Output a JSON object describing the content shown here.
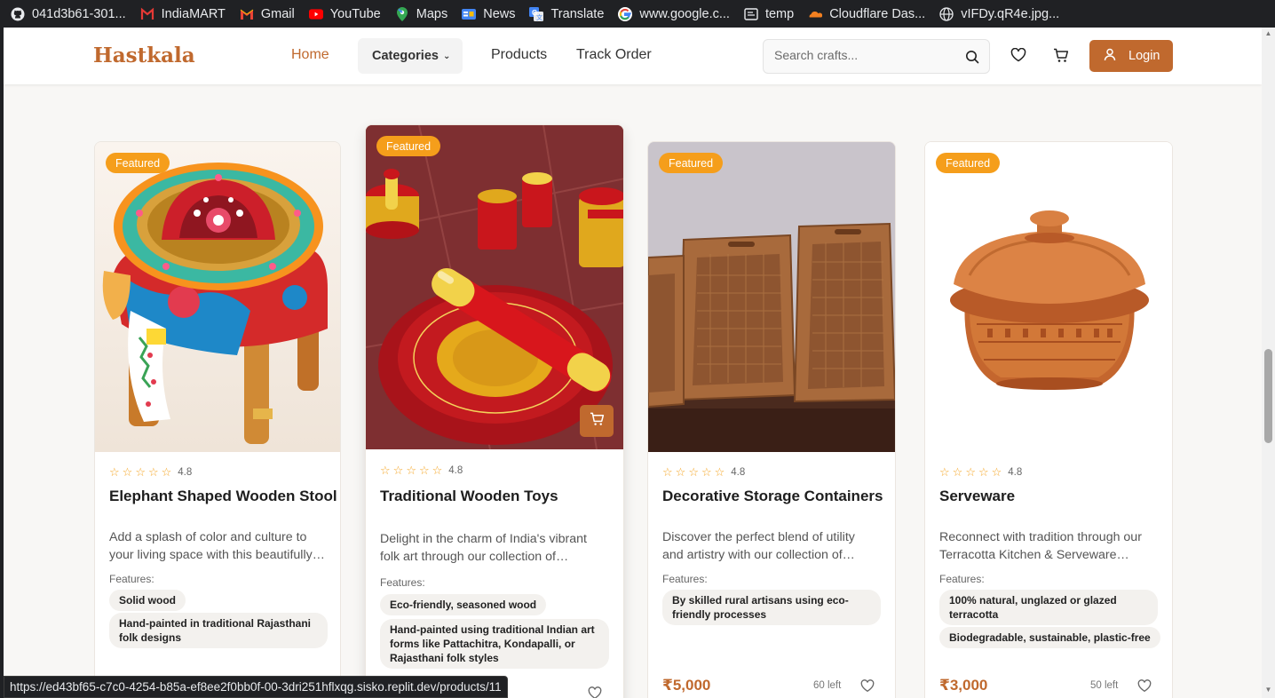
{
  "bookmarks": [
    {
      "label": "041d3b61-301...",
      "icon": "github-icon"
    },
    {
      "label": "IndiaMART",
      "icon": "indiamart-icon"
    },
    {
      "label": "Gmail",
      "icon": "gmail-icon"
    },
    {
      "label": "YouTube",
      "icon": "youtube-icon"
    },
    {
      "label": "Maps",
      "icon": "maps-icon"
    },
    {
      "label": "News",
      "icon": "news-icon"
    },
    {
      "label": "Translate",
      "icon": "translate-icon"
    },
    {
      "label": "www.google.c...",
      "icon": "google-icon"
    },
    {
      "label": "temp",
      "icon": "folder-icon"
    },
    {
      "label": "Cloudflare Das...",
      "icon": "cloudflare-icon"
    },
    {
      "label": "vIFDy.qR4e.jpg...",
      "icon": "globe-icon"
    }
  ],
  "header": {
    "logo": "Hastkala",
    "nav": {
      "home": "Home",
      "categories": "Categories",
      "products": "Products",
      "track": "Track Order"
    },
    "search_placeholder": "Search crafts...",
    "login": "Login",
    "accent": "#c0692e"
  },
  "products": [
    {
      "badge": "Featured",
      "rating": "4.8",
      "title": "Elephant Shaped Wooden Stool",
      "desc1": "Add a splash of color and culture to",
      "desc2": "your living space with this beautifully…",
      "features_label": "Features:",
      "features": [
        "Solid wood",
        "Hand-painted in traditional Rajasthani folk designs"
      ],
      "price": "",
      "stock": ""
    },
    {
      "badge": "Featured",
      "rating": "4.8",
      "title": "Traditional Wooden Toys",
      "desc1": "Delight in the charm of India's vibrant",
      "desc2": "folk art through our collection of…",
      "features_label": "Features:",
      "features": [
        "Eco-friendly, seasoned wood",
        "Hand-painted using traditional Indian art forms like Pattachitra, Kondapalli, or Rajasthani folk styles"
      ],
      "price": "",
      "stock": ""
    },
    {
      "badge": "Featured",
      "rating": "4.8",
      "title": "Decorative Storage Containers",
      "desc1": "Discover the perfect blend of utility",
      "desc2": "and artistry with our collection of…",
      "features_label": "Features:",
      "features": [
        "By skilled rural artisans using eco-friendly processes"
      ],
      "price": "₹5,000",
      "stock": "60 left"
    },
    {
      "badge": "Featured",
      "rating": "4.8",
      "title": "Serveware",
      "desc1": "Reconnect with tradition through our",
      "desc2": "Terracotta Kitchen & Serveware…",
      "features_label": "Features:",
      "features": [
        "100% natural, unglazed or glazed terracotta",
        "Biodegradable, sustainable, plastic-free"
      ],
      "price": "₹3,000",
      "stock": "50 left"
    }
  ],
  "status_url": "https://ed43bf65-c7c0-4254-b85a-ef8ee2f0bb0f-00-3dri251hflxqg.sisko.replit.dev/products/11"
}
